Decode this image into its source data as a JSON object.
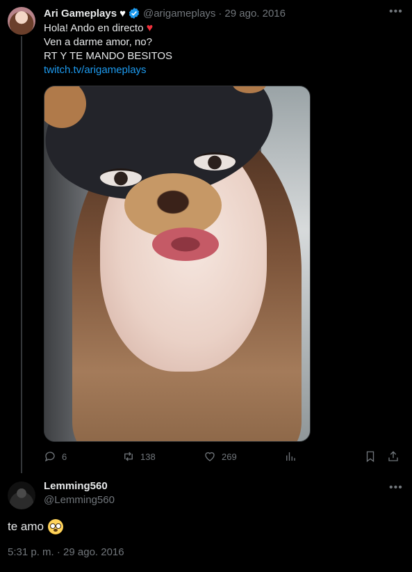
{
  "parent_tweet": {
    "display_name": "Ari Gameplays",
    "handle": "@arigameplays",
    "separator": "·",
    "date": "29 ago. 2016",
    "lines": [
      "Hola! Ando en directo",
      "Ven a darme amor, no?",
      "RT Y TE MANDO BESITOS"
    ],
    "link": "twitch.tv/arigameplays",
    "stats": {
      "replies": "6",
      "retweets": "138",
      "likes": "269"
    }
  },
  "reply_tweet": {
    "display_name": "Lemming560",
    "handle": "@Lemming560",
    "text": "te amo",
    "timestamp": "5:31 p. m. · 29 ago. 2016"
  },
  "icons": {
    "more": "more-icon",
    "reply": "reply-icon",
    "retweet": "retweet-icon",
    "like": "like-icon",
    "views": "views-icon",
    "bookmark": "bookmark-icon",
    "share": "share-icon"
  },
  "colors": {
    "background": "#000000",
    "text": "#e7e9ea",
    "muted": "#71767b",
    "link": "#1d9bf0",
    "verified": "#1d9bf0"
  }
}
